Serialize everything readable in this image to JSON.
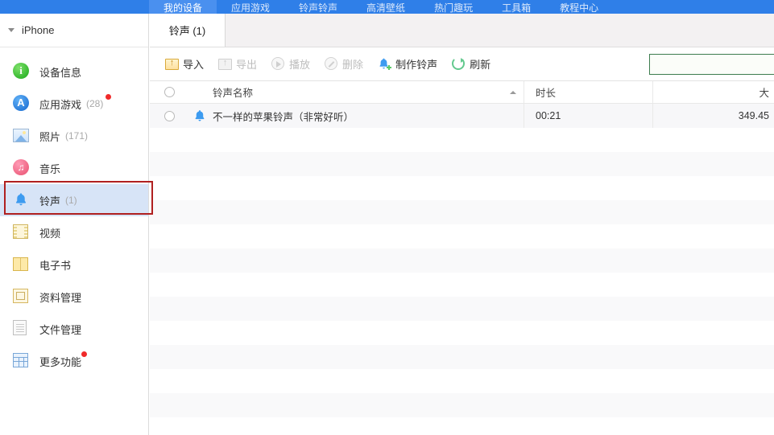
{
  "topnav": {
    "items": [
      {
        "label": "我的设备",
        "active": true
      },
      {
        "label": "应用游戏",
        "active": false
      },
      {
        "label": "铃声铃声",
        "active": false
      },
      {
        "label": "高清壁纸",
        "active": false
      },
      {
        "label": "热门趣玩",
        "active": false
      },
      {
        "label": "工具箱",
        "active": false
      },
      {
        "label": "教程中心",
        "active": false
      }
    ]
  },
  "sidebar": {
    "device": {
      "name": "iPhone",
      "caret": "caret-down-icon"
    },
    "items": [
      {
        "label": "设备信息",
        "count": "",
        "icon": "info-icon",
        "badge": false,
        "selected": false
      },
      {
        "label": "应用游戏",
        "count": "(28)",
        "icon": "appstore-icon",
        "badge": true,
        "selected": false
      },
      {
        "label": "照片",
        "count": "(171)",
        "icon": "photo-icon",
        "badge": false,
        "selected": false
      },
      {
        "label": "音乐",
        "count": "",
        "icon": "music-icon",
        "badge": false,
        "selected": false
      },
      {
        "label": "铃声",
        "count": "(1)",
        "icon": "bell-icon",
        "badge": false,
        "selected": true
      },
      {
        "label": "视频",
        "count": "",
        "icon": "video-icon",
        "badge": false,
        "selected": false
      },
      {
        "label": "电子书",
        "count": "",
        "icon": "book-icon",
        "badge": false,
        "selected": false
      },
      {
        "label": "资料管理",
        "count": "",
        "icon": "data-icon",
        "badge": false,
        "selected": false
      },
      {
        "label": "文件管理",
        "count": "",
        "icon": "file-icon",
        "badge": false,
        "selected": false
      },
      {
        "label": "更多功能",
        "count": "",
        "icon": "more-icon",
        "badge": true,
        "selected": false
      }
    ]
  },
  "tabs": [
    {
      "label": "铃声 (1)",
      "active": true
    }
  ],
  "toolbar": {
    "buttons": [
      {
        "label": "导入",
        "icon": "import-icon",
        "disabled": false
      },
      {
        "label": "导出",
        "icon": "export-icon",
        "disabled": true
      },
      {
        "label": "播放",
        "icon": "play-icon",
        "disabled": true
      },
      {
        "label": "删除",
        "icon": "delete-icon",
        "disabled": true
      },
      {
        "label": "制作铃声",
        "icon": "make-ringtone-icon",
        "disabled": false
      },
      {
        "label": "刷新",
        "icon": "refresh-icon",
        "disabled": false
      }
    ]
  },
  "search": {
    "value": "",
    "placeholder": ""
  },
  "table": {
    "columns": {
      "name": "铃声名称",
      "duration": "时长",
      "size": "大"
    },
    "rows": [
      {
        "name": "不一样的苹果铃声（非常好听）",
        "duration": "00:21",
        "size": "349.45"
      }
    ]
  },
  "colors": {
    "topbar": "#2f7fe8",
    "topbar_active": "#4a90ef",
    "sidebar_selected": "#d7e4f7",
    "annotation": "#b02020",
    "search_border": "#3d7d4f",
    "badge": "#f02a2a"
  }
}
